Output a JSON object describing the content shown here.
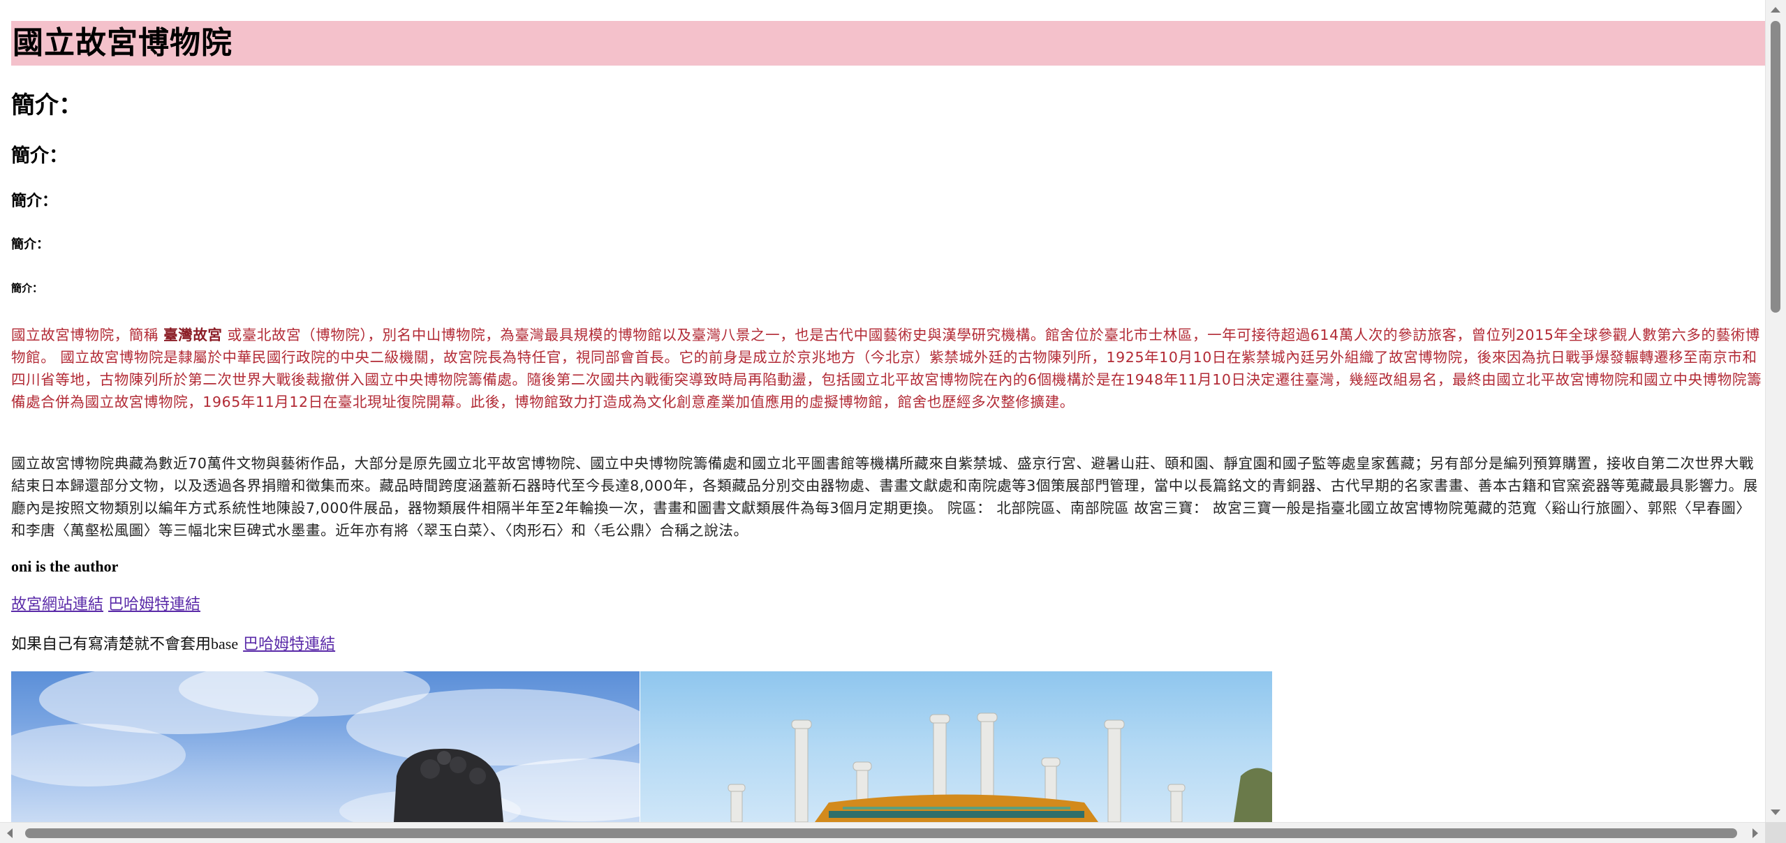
{
  "page": {
    "title": "國立故宮博物院",
    "headings": {
      "h2": "簡介：",
      "h3": "簡介：",
      "h4": "簡介：",
      "h5": "簡介：",
      "h6": "簡介："
    },
    "intro_paragraph": {
      "prefix": "國立故宮博物院，簡稱 ",
      "bold": "臺灣故宮",
      "suffix": " 或臺北故宮（博物院），別名中山博物院，為臺灣最具規模的博物館以及臺灣八景之一，也是古代中國藝術史與漢學研究機構。館舍位於臺北市士林區，一年可接待超過614萬人次的參訪旅客，曾位列2015年全球參觀人數第六多的藝術博物館。 國立故宮博物院是隸屬於中華民國行政院的中央二級機關，故宮院長為特任官，視同部會首長。它的前身是成立於京兆地方（今北京）紫禁城外廷的古物陳列所，1925年10月10日在紫禁城內廷另外組織了故宮博物院，後來因為抗日戰爭爆發輾轉遷移至南京市和四川省等地，古物陳列所於第二次世界大戰後裁撤併入國立中央博物院籌備處。隨後第二次國共內戰衝突導致時局再陷動盪，包括國立北平故宮博物院在內的6個機構於是在1948年11月10日決定遷往臺灣，幾經改組易名，最終由國立北平故宮博物院和國立中央博物院籌備處合併為國立故宮博物院，1965年11月12日在臺北現址復院開幕。此後，博物館致力打造成為文化創意產業加值應用的虛擬博物館，館舍也歷經多次整修擴建。"
    },
    "collection_paragraph": "國立故宮博物院典藏為數近70萬件文物與藝術作品，大部分是原先國立北平故宮博物院、國立中央博物院籌備處和國立北平圖書館等機構所藏來自紫禁城、盛京行宮、避暑山莊、頤和園、靜宜園和國子監等處皇家舊藏；另有部分是編列預算購置，接收自第二次世界大戰結束日本歸還部分文物，以及透過各界捐贈和徵集而來。藏品時間跨度涵蓋新石器時代至今長達8,000年，各類藏品分別交由器物處、書畫文獻處和南院處等3個策展部門管理，當中以長篇銘文的青銅器、古代早期的名家書畫、善本古籍和官窯瓷器等蒐藏最具影響力。展廳內是按照文物類別以編年方式系統性地陳設7,000件展品，器物類展件相隔半年至2年輪換一次，書畫和圖書文獻類展件為每3個月定期更換。 院區： 北部院區、南部院區 故宮三寶： 故宮三寶一般是指臺北國立故宮博物院蒐藏的范寬〈谿山行旅圖〉、郭熙〈早春圖〉和李唐〈萬壑松風圖〉等三幅北宋巨碑式水墨畫。近年亦有將〈翠玉白菜〉、〈肉形石〉和〈毛公鼎〉合稱之說法。",
    "author_line": "oni is the author",
    "links": {
      "palace_site": "故宮網站連結",
      "bahamut": "巴哈姆特連結"
    },
    "base_line": {
      "prefix_cjk": "如果自己有寫清楚就不會套用",
      "prefix_latin": "base",
      "link": "巴哈姆特連結"
    },
    "images": [
      {
        "name": "lion-statue-photo"
      },
      {
        "name": "palace-gate-photo"
      }
    ]
  },
  "colors": {
    "title_bg": "#f4c1cb",
    "intro_text": "#b22a35",
    "link": "#5a2aa8"
  }
}
